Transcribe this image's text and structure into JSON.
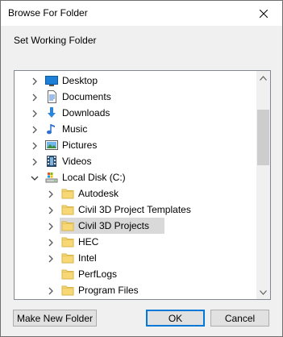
{
  "window": {
    "title": "Browse For Folder"
  },
  "instruction": "Set Working Folder",
  "tree": {
    "items": [
      {
        "label": "Desktop",
        "icon": "desktop-icon",
        "state": "collapsed"
      },
      {
        "label": "Documents",
        "icon": "documents-icon",
        "state": "collapsed"
      },
      {
        "label": "Downloads",
        "icon": "downloads-icon",
        "state": "collapsed"
      },
      {
        "label": "Music",
        "icon": "music-icon",
        "state": "collapsed"
      },
      {
        "label": "Pictures",
        "icon": "pictures-icon",
        "state": "collapsed"
      },
      {
        "label": "Videos",
        "icon": "videos-icon",
        "state": "collapsed"
      },
      {
        "label": "Local Disk (C:)",
        "icon": "drive-icon",
        "state": "expanded"
      },
      {
        "label": "Autodesk",
        "icon": "folder-icon",
        "state": "collapsed"
      },
      {
        "label": "Civil 3D Project Templates",
        "icon": "folder-icon",
        "state": "collapsed"
      },
      {
        "label": "Civil 3D Projects",
        "icon": "folder-icon",
        "state": "collapsed",
        "selected": true
      },
      {
        "label": "HEC",
        "icon": "folder-icon",
        "state": "collapsed"
      },
      {
        "label": "Intel",
        "icon": "folder-icon",
        "state": "collapsed"
      },
      {
        "label": "PerfLogs",
        "icon": "folder-icon",
        "state": "none"
      },
      {
        "label": "Program Files",
        "icon": "folder-icon",
        "state": "collapsed"
      }
    ]
  },
  "buttons": {
    "make_new_folder": "Make New Folder",
    "ok": "OK",
    "cancel": "Cancel"
  },
  "colors": {
    "selection": "#d9d9d9",
    "folder": "#f8d775",
    "accent": "#0078d7"
  }
}
